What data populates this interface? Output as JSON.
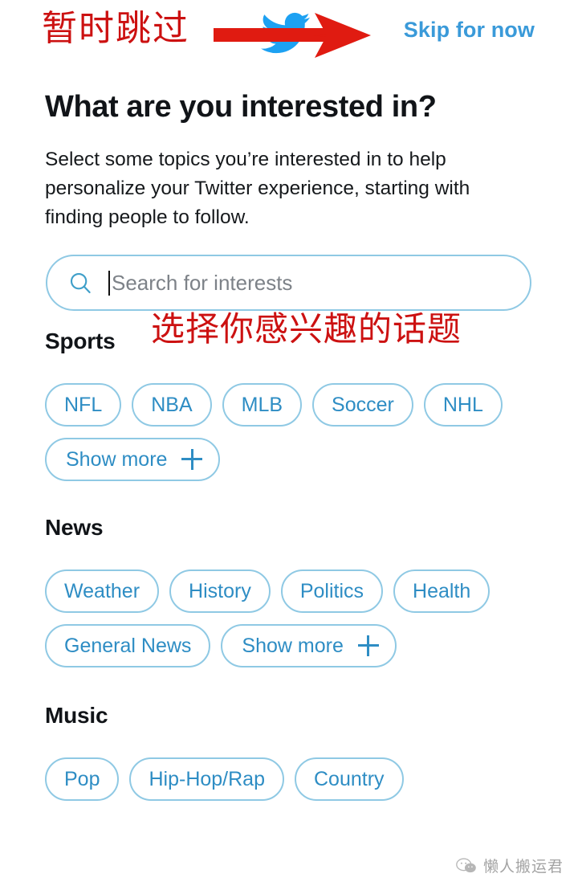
{
  "header": {
    "cn_skip_annotation": "暂时跳过",
    "logo_name": "twitter-bird-logo",
    "arrow_annotation": "red-arrow-pointing-right",
    "skip_label": "Skip for now",
    "skip_color": "#3a9ad9",
    "annotation_color": "#cc1111"
  },
  "main": {
    "title": "What are you interested in?",
    "description": "Select some topics you’re interested in to help personalize your Twitter experience, starting with finding people to follow."
  },
  "search": {
    "icon": "search-icon",
    "placeholder": "Search for interests",
    "value": ""
  },
  "annotations": {
    "topics_note": "选择你感兴趣的话题"
  },
  "sections": [
    {
      "title": "Sports",
      "chips": [
        "NFL",
        "NBA",
        "MLB",
        "Soccer",
        "NHL"
      ],
      "show_more_label": "Show more"
    },
    {
      "title": "News",
      "chips": [
        "Weather",
        "History",
        "Politics",
        "Health",
        "General News"
      ],
      "show_more_label": "Show more"
    },
    {
      "title": "Music",
      "chips": [
        "Pop",
        "Hip-Hop/Rap",
        "Country"
      ],
      "show_more_label": ""
    }
  ],
  "watermark": {
    "icon": "wechat-icon",
    "text": "懒人搬运君"
  },
  "colors": {
    "chip_border": "#8fc9e4",
    "chip_text": "#2e8dc4",
    "twitter_blue": "#1da1f2"
  }
}
